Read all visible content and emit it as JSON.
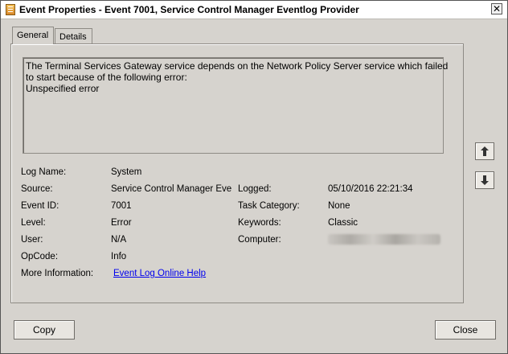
{
  "window": {
    "title": "Event Properties - Event 7001, Service Control Manager Eventlog Provider"
  },
  "tabs": [
    {
      "label": "General"
    },
    {
      "label": "Details"
    }
  ],
  "description": [
    "The Terminal Services Gateway service depends on the Network Policy Server service which failed",
    "to start because of the following error:",
    "Unspecified error"
  ],
  "fields": {
    "log_name": {
      "label": "Log Name:",
      "value": "System"
    },
    "source": {
      "label": "Source:",
      "value": "Service Control Manager Eve"
    },
    "logged": {
      "label": "Logged:",
      "value": "05/10/2016 22:21:34"
    },
    "event_id": {
      "label": "Event ID:",
      "value": "7001"
    },
    "task_category": {
      "label": "Task Category:",
      "value": "None"
    },
    "level": {
      "label": "Level:",
      "value": "Error"
    },
    "keywords": {
      "label": "Keywords:",
      "value": "Classic"
    },
    "user": {
      "label": "User:",
      "value": "N/A"
    },
    "computer": {
      "label": "Computer:"
    },
    "opcode": {
      "label": "OpCode:",
      "value": "Info"
    },
    "more_info": {
      "label": "More Information:",
      "link": "Event Log Online Help"
    }
  },
  "buttons": {
    "copy": "Copy",
    "close": "Close",
    "close_glyph": "✕"
  },
  "icons": {
    "up": "arrow-up-icon",
    "down": "arrow-down-icon",
    "title": "event-log-icon"
  }
}
